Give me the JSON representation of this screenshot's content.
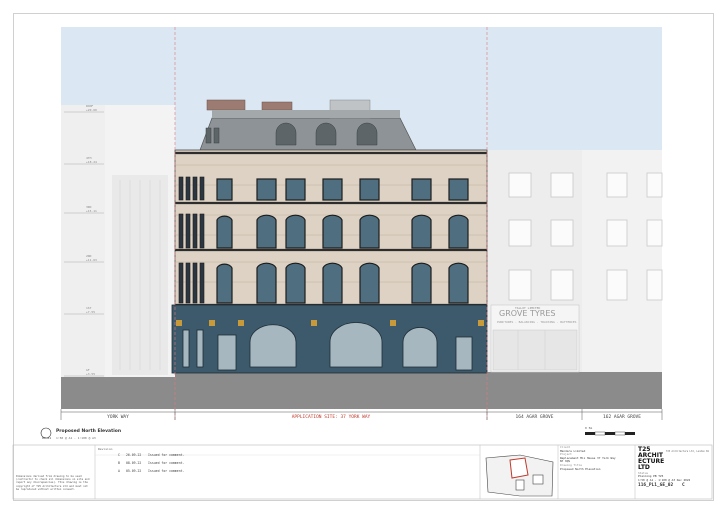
{
  "drawing": {
    "view_title": "Proposed North Elevation",
    "view_scale": "1:50 @ A1 - 1:100 @ A3",
    "view_ref": "0X.A1"
  },
  "streets": {
    "left": "YORK WAY",
    "site": "APPLICATION SITE: 37 YORK WAY",
    "right1": "164 AGAR GROVE",
    "right2": "162 AGAR GROVE"
  },
  "shop": {
    "fascia": "GROVE TYRES",
    "above": "TALLOT LIMITED",
    "sub": "PUNCTURES · BALANCING · TRACKING · BATTERIES"
  },
  "levels": [
    {
      "label": "ROOF",
      "value": "+20.60"
    },
    {
      "label": "4TH",
      "value": "+18.24"
    },
    {
      "label": "3RD",
      "value": "+15.11"
    },
    {
      "label": "2ND",
      "value": "+11.63"
    },
    {
      "label": "1ST",
      "value": "+7.55"
    },
    {
      "label": "GF",
      "value": "+3.55"
    }
  ],
  "revisions": {
    "header": "Revision",
    "rows": [
      {
        "rev": "C",
        "date": "26.09.22",
        "desc": "Issued for comment."
      },
      {
        "rev": "B",
        "date": "08.09.22",
        "desc": "Issued for comment."
      },
      {
        "rev": "A",
        "date": "05.09.22",
        "desc": "Issued for comment."
      }
    ]
  },
  "notes": "Dimensions derived from drawing to be used (contractor to check all dimensions on site and report any discrepancies). This drawing is the copyright of T25 Architecture Ltd and must not be reproduced without written consent.",
  "title_block": {
    "client_label": "Client",
    "client": "Mandora Limited",
    "project_label": "Project",
    "project": "Replacement Mix House 37 York Way N7 9QS",
    "drawing_label": "Drawing Title",
    "drawing": "Proposed North Elevation",
    "firm_line1": "T25",
    "firm_line2": "ARCHIT",
    "firm_line3": "ECTURE",
    "firm_line4": "LTD",
    "firm_address": "T25 Architecture Ltd, London N1",
    "status_label": "Status",
    "status": "Planning",
    "drawn_label": "Drawn",
    "drawn": "PB",
    "checked_label": "Checked",
    "checked": "T25",
    "scale_label": "Scale",
    "scale": "1:50 @ A1 · 1:100 @ A3",
    "date_label": "Date",
    "date": "Dec 2022",
    "number_label": "Drawing No.",
    "number": "116_PL1_GE_02",
    "rev_label": "Revision",
    "rev": "C"
  },
  "scale_bar": {
    "label": "0      5m"
  },
  "colors": {
    "sky": "#dbe8f3",
    "ground": "#888888",
    "stucco": "#ddd2c3",
    "shopfront": "#3d5a6c",
    "site_line": "#e07a7a"
  }
}
